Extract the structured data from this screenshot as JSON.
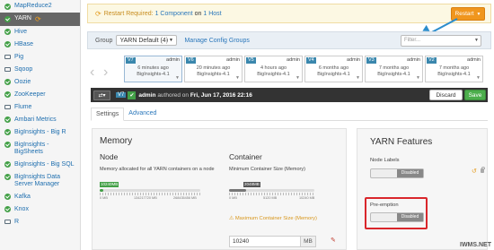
{
  "sidebar": {
    "items": [
      {
        "label": "MapReduce2",
        "icon": "check-icon",
        "active": false
      },
      {
        "label": "YARN",
        "icon": "check-icon",
        "active": true,
        "badge_icon": "refresh-icon"
      },
      {
        "label": "Hive",
        "icon": "check-icon",
        "active": false
      },
      {
        "label": "HBase",
        "icon": "check-icon",
        "active": false
      },
      {
        "label": "Pig",
        "icon": "laptop-icon",
        "active": false
      },
      {
        "label": "Sqoop",
        "icon": "laptop-icon",
        "active": false
      },
      {
        "label": "Oozie",
        "icon": "check-icon",
        "active": false
      },
      {
        "label": "ZooKeeper",
        "icon": "check-icon",
        "active": false
      },
      {
        "label": "Flume",
        "icon": "laptop-icon",
        "active": false
      },
      {
        "label": "Ambari Metrics",
        "icon": "check-icon",
        "active": false
      },
      {
        "label": "BigInsights - Big R",
        "icon": "check-icon",
        "active": false
      },
      {
        "label": "BigInsights - BigSheets",
        "icon": "check-icon",
        "active": false
      },
      {
        "label": "BigInsights - Big SQL",
        "icon": "check-icon",
        "active": false
      },
      {
        "label": "BigInsights Data Server Manager",
        "icon": "check-icon",
        "active": false
      },
      {
        "label": "Kafka",
        "icon": "check-icon",
        "active": false
      },
      {
        "label": "Knox",
        "icon": "check-icon",
        "active": false
      },
      {
        "label": "R",
        "icon": "laptop-icon",
        "active": false
      }
    ]
  },
  "alert": {
    "prefix": "Restart Required:",
    "components": "1 Component",
    "on": "on",
    "hosts": "1 Host",
    "restart_label": "Restart"
  },
  "group": {
    "label": "Group",
    "selected": "YARN Default (4)",
    "manage_label": "Manage Config Groups",
    "filter_placeholder": "Filter..."
  },
  "versions": [
    {
      "num": "V7",
      "user": "admin",
      "time": "6 minutes ago",
      "sub": "BigInsights-4.1",
      "current": true
    },
    {
      "num": "V6",
      "user": "admin",
      "time": "20 minutes ago",
      "sub": "BigInsights-4.1",
      "current": false
    },
    {
      "num": "V5",
      "user": "admin",
      "time": "4 hours ago",
      "sub": "BigInsights-4.1",
      "current": false
    },
    {
      "num": "V4",
      "user": "admin",
      "time": "6 months ago",
      "sub": "BigInsights-4.1",
      "current": false
    },
    {
      "num": "V3",
      "user": "admin",
      "time": "7 months ago",
      "sub": "BigInsights-4.1",
      "current": false
    },
    {
      "num": "V2",
      "user": "admin",
      "time": "7 months ago",
      "sub": "BigInsights-4.1",
      "current": false
    }
  ],
  "actionbar": {
    "version": "V7",
    "author": "admin",
    "authored_text": "authored on",
    "date": "Fri, Jun 17, 2016 22:16",
    "discard_label": "Discard",
    "save_label": "Save"
  },
  "tabs": [
    {
      "label": "Settings",
      "active": true
    },
    {
      "label": "Advanced",
      "active": false
    }
  ],
  "memory": {
    "title": "Memory",
    "node": {
      "title": "Node",
      "desc": "Memory allocated for all YARN containers on a node",
      "badge": "10240MB",
      "value_fraction": 0.04,
      "ticks": [
        "0 MB",
        "134217720 MB",
        "268435456 MB"
      ]
    },
    "container": {
      "title": "Container",
      "desc": "Minimum Container Size (Memory)",
      "badge": "2048MB",
      "value_fraction": 0.2,
      "ticks": [
        "0 MB",
        "5120 MB",
        "10240 MB"
      ],
      "max_label": "Maximum Container Size (Memory)",
      "input_value": "10240",
      "unit": "MB"
    }
  },
  "features": {
    "title": "YARN Features",
    "node_labels": {
      "label": "Node Labels",
      "state": "Disabled"
    },
    "preemption": {
      "label": "Pre-emption",
      "state": "Disabled"
    }
  },
  "watermark": "IWMS.NET",
  "colors": {
    "accent": "#2a77bb",
    "warning": "#f0961e",
    "success": "#4cae4c",
    "highlight": "#d9262b"
  }
}
